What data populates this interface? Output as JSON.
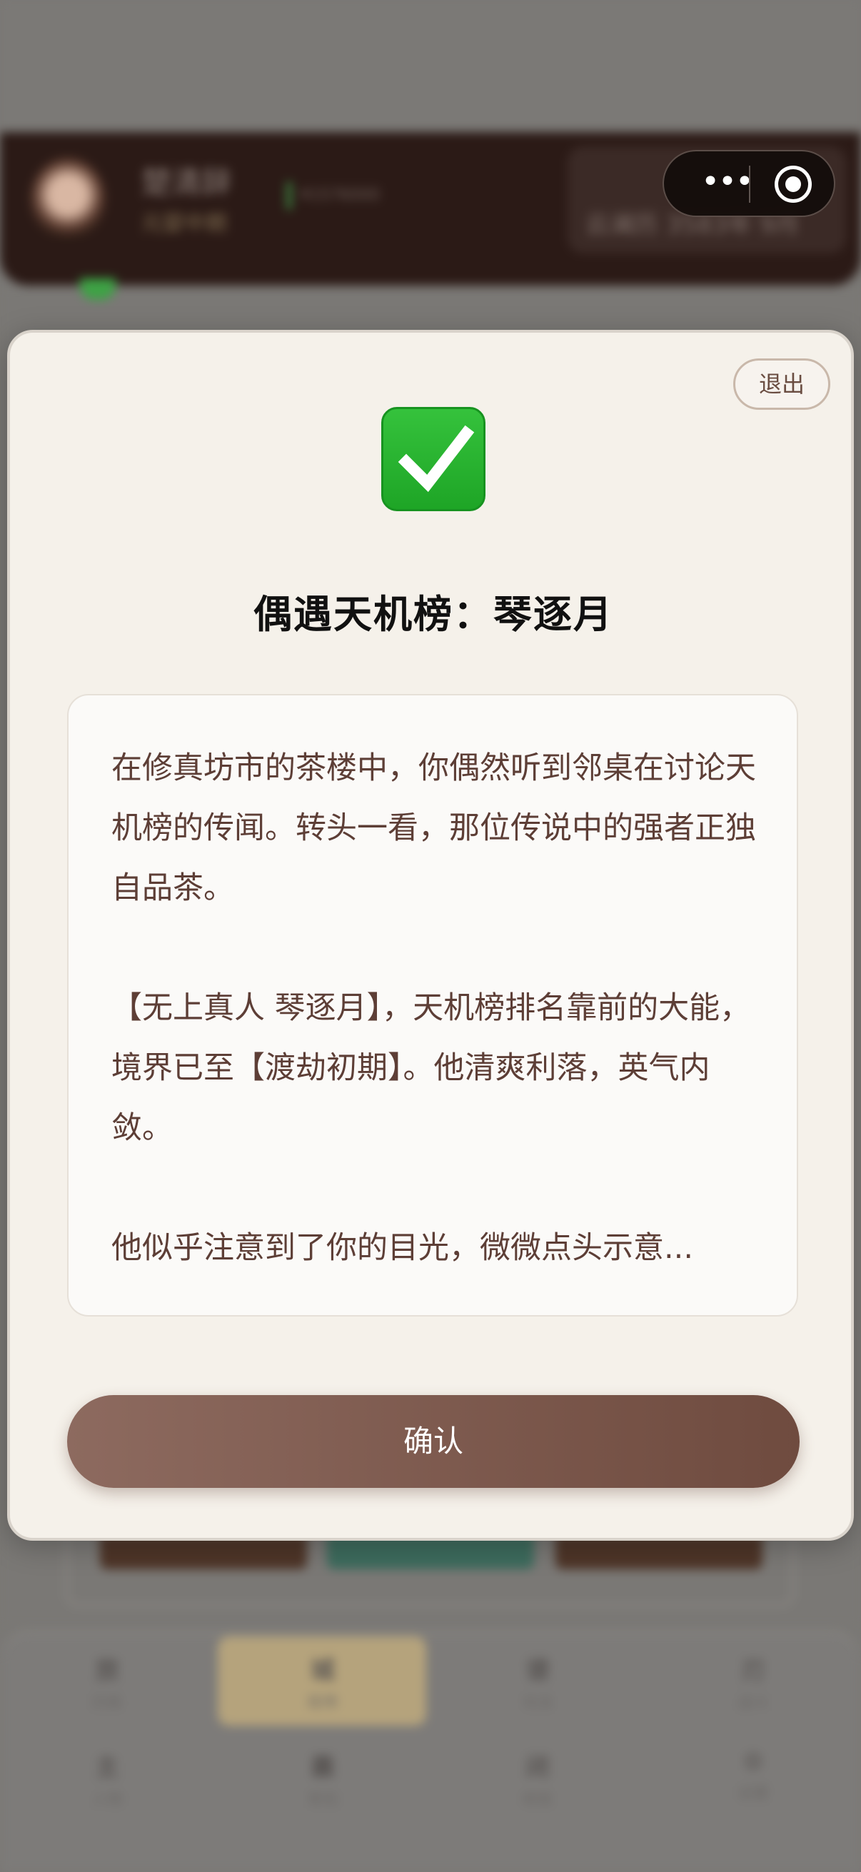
{
  "background": {
    "player_name": "楚清辞",
    "player_realm": "元婴中期",
    "resource_bar": "¥1576000",
    "location_tag": "云澜历 3583年 9月",
    "bottom_nav": [
      {
        "glyph": "旅",
        "label": "历练"
      },
      {
        "glyph": "城",
        "label": "坊市"
      },
      {
        "glyph": "谱",
        "label": "功法"
      },
      {
        "glyph": "刃",
        "label": "战斗"
      },
      {
        "glyph": "主",
        "label": "人物"
      },
      {
        "glyph": "囊",
        "label": "背包"
      },
      {
        "glyph": "闭",
        "label": "修炼"
      },
      {
        "glyph": "⚙",
        "label": "设置"
      }
    ]
  },
  "capsule": {
    "more_icon": "more-dots-icon",
    "close_icon": "target-circle-icon"
  },
  "modal": {
    "exit_label": "退出",
    "status_icon": "check-mark-icon",
    "icon_color": "#2fb534",
    "title": "偶遇天机榜：琴逐月",
    "paragraphs": [
      "在修真坊市的茶楼中，你偶然听到邻桌在讨论天机榜的传闻。转头一看，那位传说中的强者正独自品茶。",
      "【无上真人 琴逐月】，天机榜排名靠前的大能，境界已至【渡劫初期】。他清爽利落，英气内敛。",
      "他似乎注意到了你的目光，微微点头示意..."
    ],
    "confirm_label": "确认",
    "accent_color": "#7c5a4e"
  }
}
